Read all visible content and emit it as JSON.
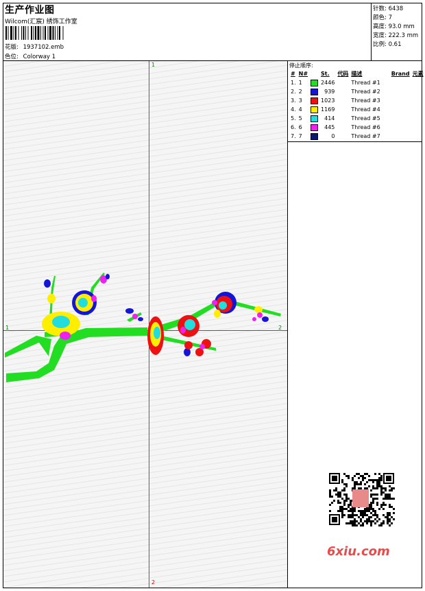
{
  "header": {
    "title": "生产作业图",
    "subtitle": "Wilcom(汇宸) 绣饰工作室",
    "design_label": "花版:",
    "design_value": "1937102.emb",
    "colorway_label": "色位:",
    "colorway_value": "Colorway 1"
  },
  "stats": {
    "stitches": "针数: 6438",
    "colors": "颜色: 7",
    "height": "高度: 93.0 mm",
    "width": "宽度: 222.3 mm",
    "scale": "比例: 0.61"
  },
  "axis_labels": {
    "top": "1",
    "left": "1",
    "right": "2",
    "bottom": "2"
  },
  "thread_table": {
    "heading": "停止顺序:",
    "columns": [
      "#",
      "N#",
      "St.",
      "代码",
      "描述",
      "Brand",
      "元素"
    ],
    "rows": [
      {
        "index": "1.",
        "n": "1",
        "color": "#22dd22",
        "stitches": "2446",
        "desc": "Thread #1"
      },
      {
        "index": "2.",
        "n": "2",
        "color": "#1515d8",
        "stitches": "939",
        "desc": "Thread #2"
      },
      {
        "index": "3.",
        "n": "3",
        "color": "#ee1111",
        "stitches": "1023",
        "desc": "Thread #3"
      },
      {
        "index": "4.",
        "n": "4",
        "color": "#ffee00",
        "stitches": "1169",
        "desc": "Thread #4"
      },
      {
        "index": "5.",
        "n": "5",
        "color": "#22dddd",
        "stitches": "414",
        "desc": "Thread #5"
      },
      {
        "index": "6.",
        "n": "6",
        "color": "#ee22ee",
        "stitches": "445",
        "desc": "Thread #6"
      },
      {
        "index": "7.",
        "n": "7",
        "color": "#0b1a6e",
        "stitches": "0",
        "desc": "Thread #7"
      }
    ]
  },
  "watermark": "6xiu.com",
  "colors": {
    "crosshair": "#d62a2a",
    "branch": "#22dd22",
    "petal_blue": "#1515d8",
    "petal_red": "#ee1111",
    "petal_yellow": "#ffee00",
    "center_cyan": "#22dddd",
    "magenta": "#ee22ee"
  },
  "icons": {
    "barcode": "barcode-icon",
    "qr": "qr-code-icon"
  }
}
